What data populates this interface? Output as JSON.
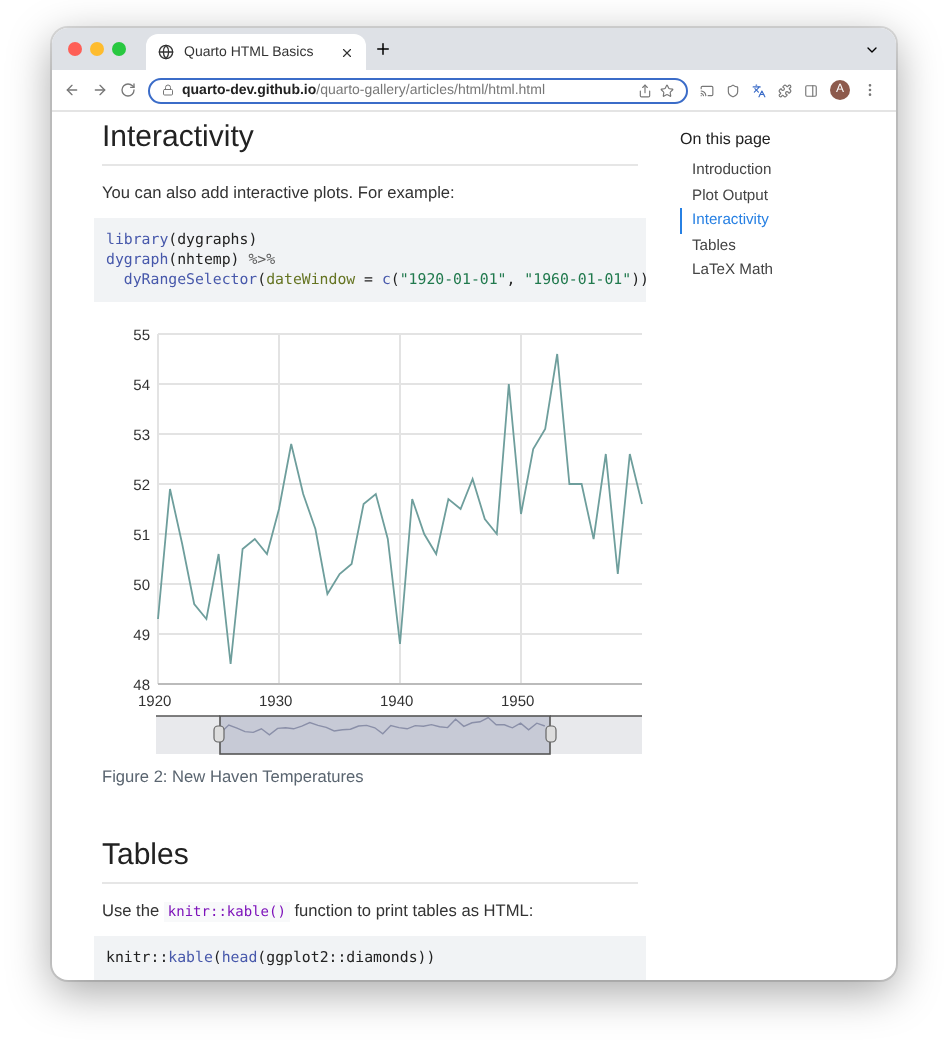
{
  "browser": {
    "tab_title": "Quarto HTML Basics",
    "url_domain": "quarto-dev.github.io",
    "url_path": "/quarto-gallery/articles/html/html.html",
    "avatar": "A"
  },
  "article": [
    {
      "kind": "heading",
      "text": "Interactivity"
    },
    {
      "kind": "paragraph",
      "parts": [
        {
          "kind": "text",
          "text": "You can also add interactive plots. For example:"
        }
      ]
    },
    {
      "kind": "code",
      "lines": [
        {
          "indent": false,
          "tokens": [
            {
              "kind": "fn",
              "text": "library"
            },
            {
              "kind": "plain",
              "text": "(dygraphs)"
            }
          ]
        },
        {
          "indent": false,
          "tokens": [
            {
              "kind": "fn",
              "text": "dygraph"
            },
            {
              "kind": "plain",
              "text": "(nhtemp) "
            },
            {
              "kind": "op",
              "text": "%>%"
            }
          ]
        },
        {
          "indent": true,
          "tokens": [
            {
              "kind": "fn",
              "text": "dyRangeSelector"
            },
            {
              "kind": "plain",
              "text": "("
            },
            {
              "kind": "arg",
              "text": "dateWindow"
            },
            {
              "kind": "plain",
              "text": " = "
            },
            {
              "kind": "fn",
              "text": "c"
            },
            {
              "kind": "plain",
              "text": "("
            },
            {
              "kind": "string",
              "text": "\"1920-01-01\""
            },
            {
              "kind": "plain",
              "text": ", "
            },
            {
              "kind": "string",
              "text": "\"1960-01-01\""
            },
            {
              "kind": "plain",
              "text": "))"
            }
          ]
        }
      ]
    },
    {
      "kind": "chart",
      "caption": "Figure 2: New Haven Temperatures",
      "chart_data": {
        "type": "line",
        "x": [
          1920,
          1921,
          1922,
          1923,
          1924,
          1925,
          1926,
          1927,
          1928,
          1929,
          1930,
          1931,
          1932,
          1933,
          1934,
          1935,
          1936,
          1937,
          1938,
          1939,
          1940,
          1941,
          1942,
          1943,
          1944,
          1945,
          1946,
          1947,
          1948,
          1949,
          1950,
          1951,
          1952,
          1953,
          1954,
          1955,
          1956,
          1957,
          1958,
          1959,
          1960
        ],
        "series": [
          {
            "color": "#6e9e9c",
            "values": [
              49.3,
              51.9,
              50.8,
              49.6,
              49.3,
              50.6,
              48.4,
              50.7,
              50.9,
              50.6,
              51.5,
              52.8,
              51.8,
              51.1,
              49.8,
              50.2,
              50.4,
              51.6,
              51.8,
              50.9,
              48.8,
              51.7,
              51.0,
              50.6,
              51.7,
              51.5,
              52.1,
              51.3,
              51.0,
              54.0,
              51.4,
              52.7,
              53.1,
              54.6,
              52.0,
              52.0,
              50.9,
              52.6,
              50.2,
              52.6,
              51.6
            ]
          }
        ],
        "xlim": [
          1920,
          1960
        ],
        "ylim": [
          48,
          55
        ],
        "xticks": [
          1920,
          1930,
          1940,
          1950
        ],
        "yticks": [
          48,
          49,
          50,
          51,
          52,
          53,
          54,
          55
        ],
        "grid": true
      }
    },
    {
      "kind": "heading",
      "text": "Tables"
    },
    {
      "kind": "paragraph",
      "parts": [
        {
          "kind": "text",
          "text": "Use the "
        },
        {
          "kind": "code",
          "text": "knitr::kable()"
        },
        {
          "kind": "text",
          "text": " function to print tables as HTML:"
        }
      ]
    },
    {
      "kind": "code",
      "lines": [
        {
          "indent": false,
          "tokens": [
            {
              "kind": "plain",
              "text": "knitr::"
            },
            {
              "kind": "fn",
              "text": "kable"
            },
            {
              "kind": "plain",
              "text": "("
            },
            {
              "kind": "fn",
              "text": "head"
            },
            {
              "kind": "plain",
              "text": "(ggplot2::diamonds))"
            }
          ]
        }
      ]
    }
  ],
  "toc": {
    "title": "On this page",
    "items": [
      {
        "label": "Introduction",
        "selected": false
      },
      {
        "label": "Plot Output",
        "selected": false
      },
      {
        "label": "Interactivity",
        "selected": true
      },
      {
        "label": "Tables",
        "selected": false
      },
      {
        "label": "LaTeX Math",
        "selected": false
      }
    ]
  }
}
